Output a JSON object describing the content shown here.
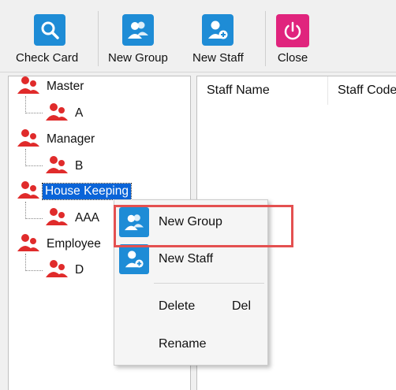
{
  "toolbar": {
    "check_card": "Check Card",
    "new_group": "New Group",
    "new_staff": "New Staff",
    "close": "Close"
  },
  "colors": {
    "accent_blue": "#1e8cd6",
    "close_pink": "#e0247d",
    "person_red": "#e02b2b",
    "selection": "#0a64d8",
    "highlight_box": "#e45050"
  },
  "tree": {
    "nodes": [
      {
        "label": "Master",
        "level": 0
      },
      {
        "label": "A",
        "level": 1
      },
      {
        "label": "Manager",
        "level": 0
      },
      {
        "label": "B",
        "level": 1
      },
      {
        "label": "House Keeping",
        "level": 0,
        "selected": true
      },
      {
        "label": "AAA",
        "level": 1
      },
      {
        "label": "Employee",
        "level": 0
      },
      {
        "label": "D",
        "level": 1
      }
    ]
  },
  "table": {
    "columns": [
      "Staff Name",
      "Staff Code"
    ]
  },
  "context_menu": {
    "new_group": "New Group",
    "new_staff": "New Staff",
    "delete": "Delete",
    "delete_shortcut": "Del",
    "rename": "Rename"
  }
}
